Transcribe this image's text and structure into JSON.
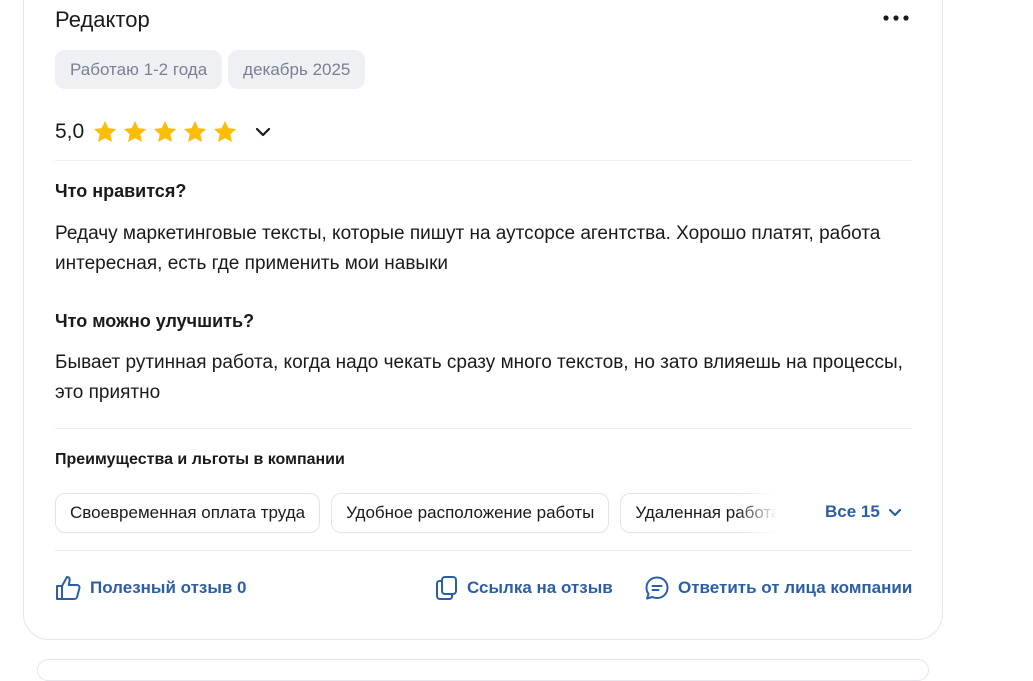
{
  "review": {
    "title": "Редактор",
    "more_icon": "more-horizontal-icon",
    "tags": [
      "Работаю 1-2 года",
      "декабрь 2025"
    ],
    "rating": {
      "value_text": "5,0",
      "stars": 5,
      "star_color": "#fbbd08"
    },
    "likes": {
      "title": "Что нравится?",
      "text": "Редачу маркетинговые тексты, которые пишут на аутсорсе агентства. Хорошо платят, работа интересная, есть где применить мои навыки"
    },
    "improve": {
      "title": "Что можно улучшить?",
      "text": "Бывает рутинная работа, когда надо чекать сразу много текстов, но зато влияешь на процессы, это приятно"
    },
    "benefits": {
      "title": "Преимущества и льготы в компании",
      "chips": [
        "Своевременная оплата труда",
        "Удобное расположение работы",
        "Удаленная работа"
      ],
      "all_label": "Все 15"
    },
    "footer": {
      "helpful_label": "Полезный отзыв 0",
      "link_label": "Ссылка на отзыв",
      "reply_label": "Ответить от лица компании"
    }
  },
  "colors": {
    "accent": "#2c5ea8",
    "tag_bg": "#eef0f4",
    "tag_text": "#7a8090"
  }
}
